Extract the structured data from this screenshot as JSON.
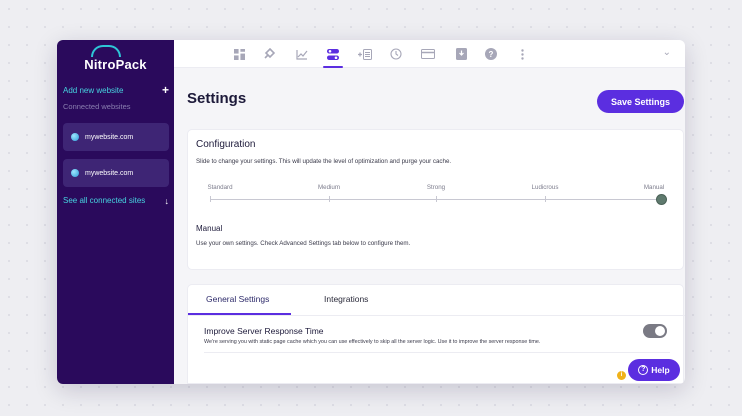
{
  "app": {
    "brand": "NitroPack"
  },
  "sidebar": {
    "add_site": "Add new website",
    "connected_label": "Connected websites",
    "sites": [
      "mywebsite.com",
      "mywebsite.com"
    ],
    "see_all": "See all connected sites"
  },
  "topbar": {
    "icons": [
      "dashboard-icon",
      "plugin-icon",
      "chart-icon",
      "settings-toggle-icon",
      "subscription-add-icon",
      "history-icon",
      "billing-card-icon",
      "download-icon",
      "help-circle-icon",
      "more-vertical-icon"
    ],
    "active": "settings-toggle-icon"
  },
  "page": {
    "title": "Settings",
    "save_label": "Save Settings"
  },
  "configuration": {
    "title": "Configuration",
    "subtitle": "Slide to change your settings. This will update the level of optimization and purge your cache.",
    "levels": [
      "Standard",
      "Medium",
      "Strong",
      "Ludicrous",
      "Manual"
    ],
    "selected_level": "Manual",
    "mode_title": "Manual",
    "mode_description": "Use your own settings. Check Advanced Settings tab below to configure them."
  },
  "advanced": {
    "tabs": [
      "General Settings",
      "Integrations"
    ],
    "active_tab": "General Settings",
    "server_response": {
      "title": "Improve Server Response Time",
      "description": "We're serving you with static page cache which you can use effectively to skip all the server logic. Use it to improve the server response time.",
      "enabled": true
    }
  },
  "help": {
    "label": "Help",
    "info": "i"
  },
  "colors": {
    "primary": "#5b2ee0",
    "sidebar": "#2a0a5c",
    "accent": "#46d4e0"
  }
}
